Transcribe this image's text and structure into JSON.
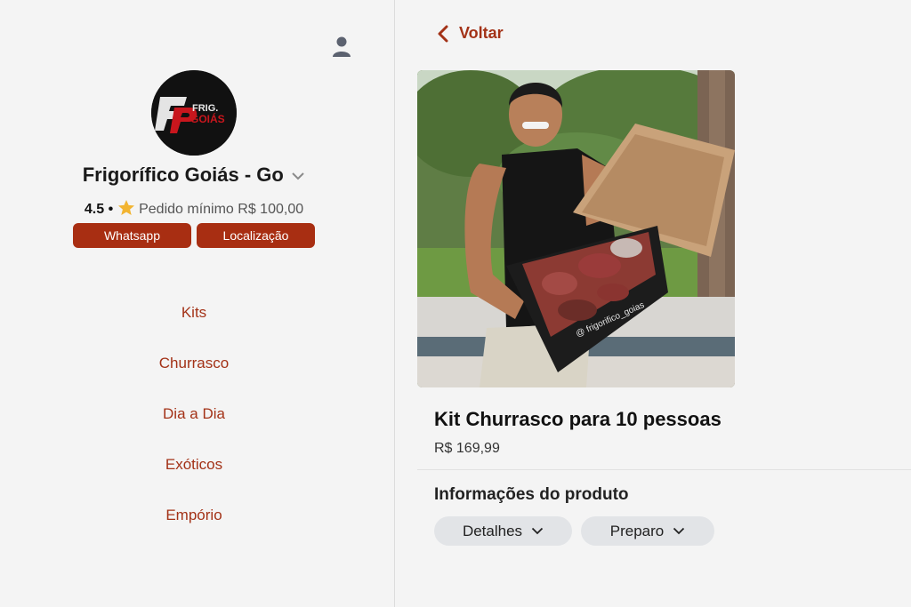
{
  "store": {
    "name": "Frigorífico Goiás - Go",
    "rating": "4.5",
    "separator": "•",
    "min_order": "Pedido mínimo R$ 100,00",
    "logo_text_top": "FRIG.",
    "logo_text_bottom": "GOIÁS",
    "buttons": {
      "whatsapp": "Whatsapp",
      "location": "Localização"
    }
  },
  "categories": [
    "Kits",
    "Churrasco",
    "Dia a Dia",
    "Exóticos",
    "Empório"
  ],
  "nav": {
    "back_label": "Voltar"
  },
  "product": {
    "title": "Kit Churrasco para 10 pessoas",
    "price": "R$ 169,99",
    "box_label": "@ frigorifico_goias",
    "info_heading": "Informações do produto",
    "tabs": [
      "Detalhes",
      "Preparo"
    ]
  },
  "colors": {
    "accent": "#a82e12",
    "category_text": "#a33217",
    "background": "#f4f4f4",
    "tab_bg": "#e2e4e7"
  },
  "icons": {
    "user": "user-icon",
    "chevron_store": "chevron-down-icon",
    "star": "star-icon",
    "back": "chevron-left-icon",
    "tab_chevron": "chevron-down-icon"
  }
}
